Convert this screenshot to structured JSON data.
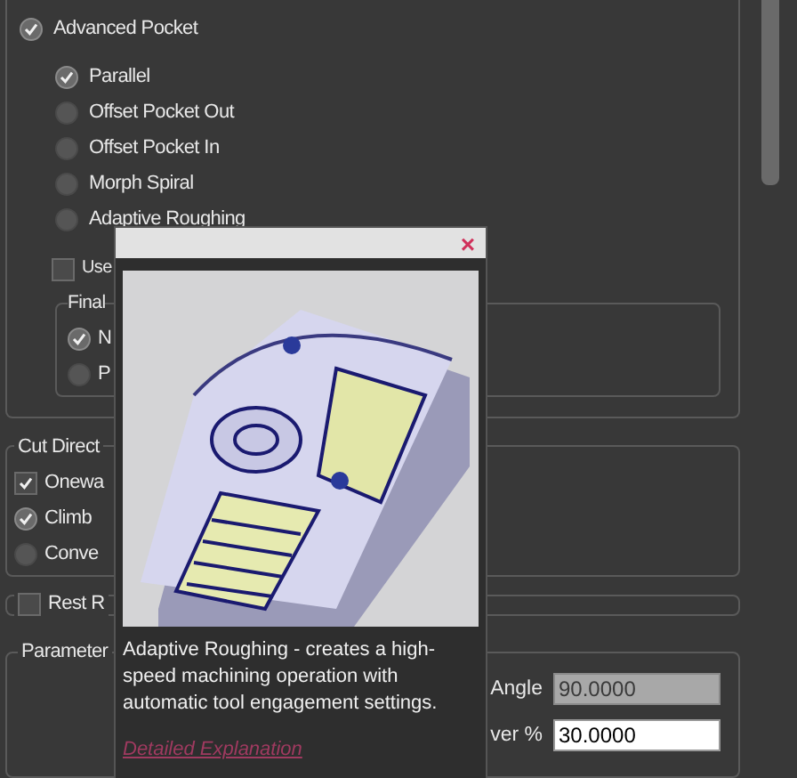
{
  "advanced_pocket": {
    "label": "Advanced Pocket",
    "checked": true
  },
  "strategies": [
    {
      "label": "Parallel",
      "selected": true
    },
    {
      "label": "Offset Pocket Out",
      "selected": false
    },
    {
      "label": "Offset Pocket In",
      "selected": false
    },
    {
      "label": "Morph Spiral",
      "selected": false
    },
    {
      "label": "Adaptive Roughing",
      "selected": false
    }
  ],
  "use_option": {
    "label": "Use",
    "checked": false
  },
  "final_group": {
    "title": "Final",
    "options": [
      {
        "label": "N",
        "selected": true
      },
      {
        "label": "P",
        "selected": false
      }
    ]
  },
  "cut_direction": {
    "title": "Cut Direct",
    "items": [
      {
        "kind": "checkbox",
        "label": "Onewa",
        "checked": true
      },
      {
        "kind": "radio",
        "label": "Climb",
        "selected": true
      },
      {
        "kind": "radio",
        "label": "Conve",
        "selected": false
      }
    ]
  },
  "rest_group": {
    "label": "Rest R",
    "checked": false
  },
  "parameters": {
    "title": "Parameter",
    "fields": [
      {
        "label": "Angle",
        "value": "90.0000",
        "disabled": true
      },
      {
        "label": "ver %",
        "value": "30.0000",
        "disabled": false
      }
    ]
  },
  "tooltip": {
    "close": "×",
    "description": "Adaptive Roughing - creates a high-speed machining operation with automatic tool engagement settings.",
    "link": "Detailed Explanation"
  }
}
